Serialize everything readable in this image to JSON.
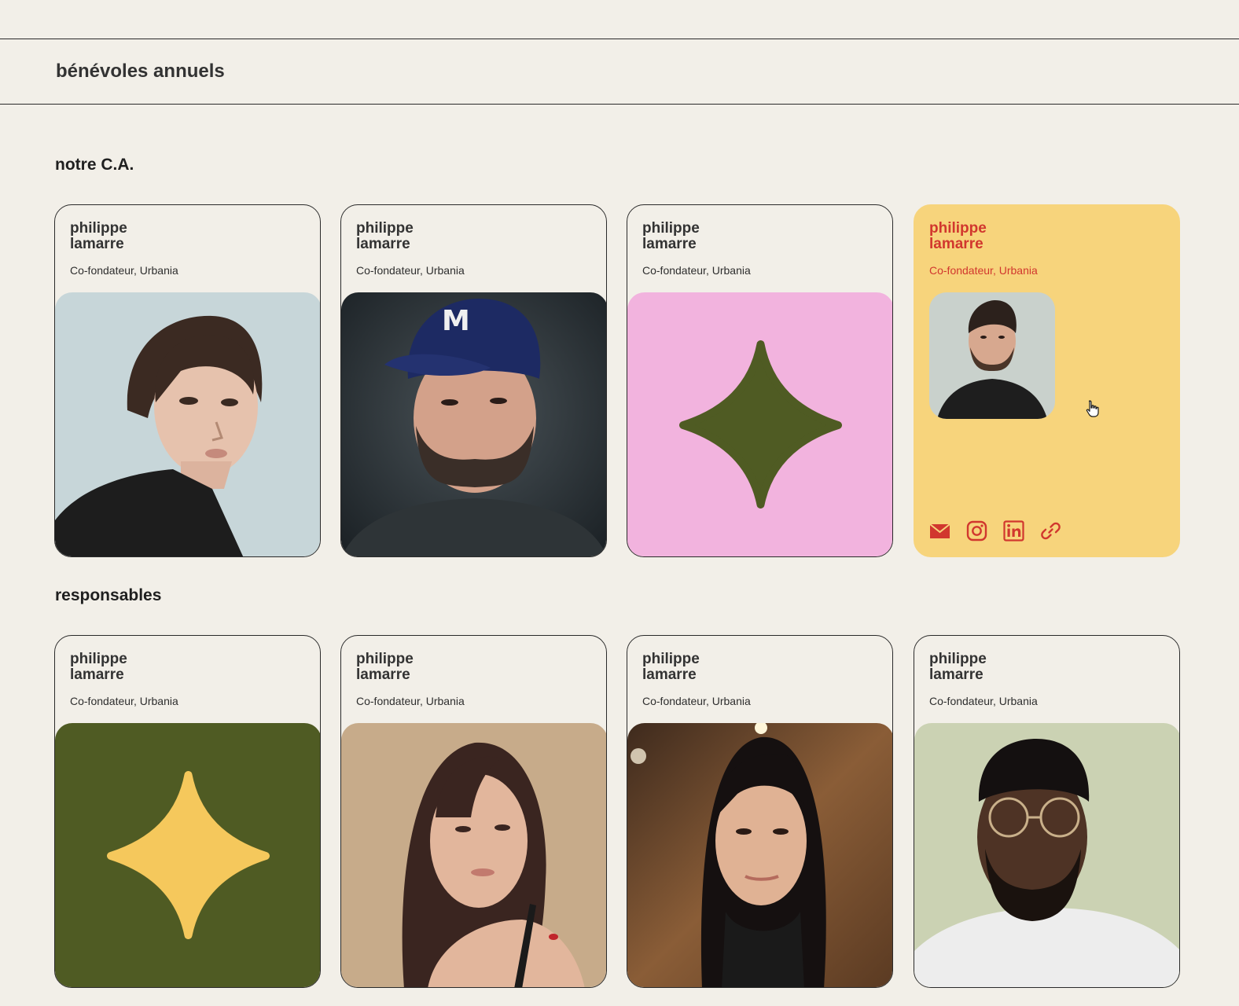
{
  "header": {
    "title": "bénévoles annuels"
  },
  "sections": [
    {
      "title": "notre C.A.",
      "cards": [
        {
          "name": "philippe\nlamarre",
          "role": "Co-fondateur, Urbania",
          "media": "portrait-photo"
        },
        {
          "name": "philippe\nlamarre",
          "role": "Co-fondateur, Urbania",
          "media": "portrait-photo"
        },
        {
          "name": "philippe\nlamarre",
          "role": "Co-fondateur, Urbania",
          "media": "star-placeholder"
        },
        {
          "name": "philippe\nlamarre",
          "role": "Co-fondateur, Urbania",
          "media": "portrait-thumbnail",
          "state": "hover",
          "socials": [
            "mail-icon",
            "instagram-icon",
            "linkedin-icon",
            "link-icon"
          ]
        }
      ]
    },
    {
      "title": "responsables",
      "cards": [
        {
          "name": "philippe\nlamarre",
          "role": "Co-fondateur, Urbania",
          "media": "star-placeholder"
        },
        {
          "name": "philippe\nlamarre",
          "role": "Co-fondateur, Urbania",
          "media": "portrait-photo"
        },
        {
          "name": "philippe\nlamarre",
          "role": "Co-fondateur, Urbania",
          "media": "portrait-photo"
        },
        {
          "name": "philippe\nlamarre",
          "role": "Co-fondateur, Urbania",
          "media": "portrait-photo"
        }
      ]
    }
  ],
  "colors": {
    "background": "#f2efe8",
    "hover_card": "#f7d47c",
    "accent_red": "#d1372e",
    "olive": "#4f5b23",
    "pink": "#f2b3de",
    "star_yellow": "#f5c85c"
  }
}
